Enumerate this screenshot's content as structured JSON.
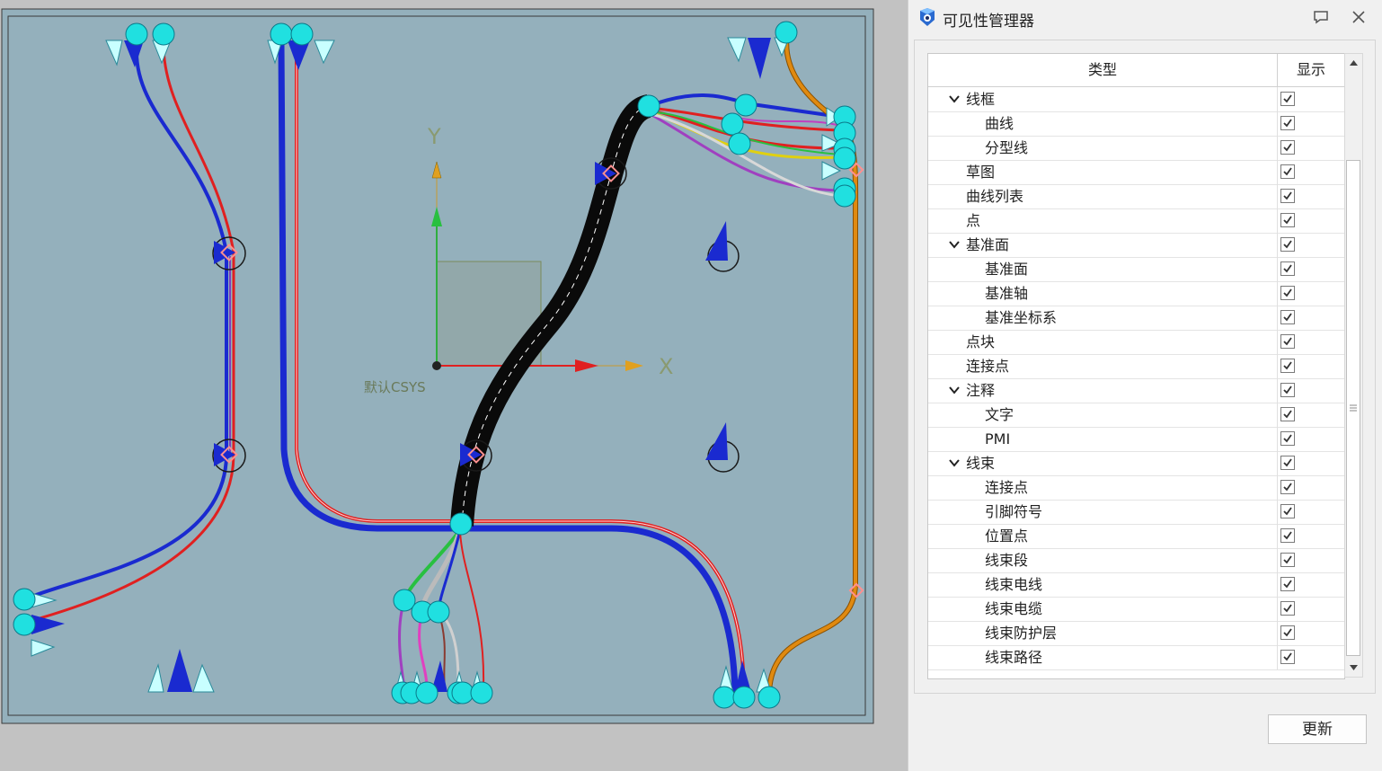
{
  "viewport": {
    "axis_x_label": "X",
    "axis_y_label": "Y",
    "csys_label": "默认CSYS",
    "colors": {
      "background": "#94b0bc",
      "wire_red": "#e02020",
      "wire_blue": "#1a2ad0",
      "bundle_black": "#0a0a0a",
      "cable_orange": "#e08a10",
      "connector_cyan": "#20e0e0"
    }
  },
  "panel": {
    "title": "可见性管理器",
    "logo_icon": "visibility-manager-icon",
    "columns": {
      "type": "类型",
      "show": "显示"
    },
    "items": [
      {
        "label": "线框",
        "level": 0,
        "expandable": true,
        "checked": true
      },
      {
        "label": "曲线",
        "level": 1,
        "expandable": false,
        "checked": true
      },
      {
        "label": "分型线",
        "level": 1,
        "expandable": false,
        "checked": true
      },
      {
        "label": "草图",
        "level": 0,
        "expandable": false,
        "checked": true
      },
      {
        "label": "曲线列表",
        "level": 0,
        "expandable": false,
        "checked": true
      },
      {
        "label": "点",
        "level": 0,
        "expandable": false,
        "checked": true
      },
      {
        "label": "基准面",
        "level": 0,
        "expandable": true,
        "checked": true
      },
      {
        "label": "基准面",
        "level": 1,
        "expandable": false,
        "checked": true
      },
      {
        "label": "基准轴",
        "level": 1,
        "expandable": false,
        "checked": true
      },
      {
        "label": "基准坐标系",
        "level": 1,
        "expandable": false,
        "checked": true
      },
      {
        "label": "点块",
        "level": 0,
        "expandable": false,
        "checked": true
      },
      {
        "label": "连接点",
        "level": 0,
        "expandable": false,
        "checked": true
      },
      {
        "label": "注释",
        "level": 0,
        "expandable": true,
        "checked": true
      },
      {
        "label": "文字",
        "level": 1,
        "expandable": false,
        "checked": true
      },
      {
        "label": "PMI",
        "level": 1,
        "expandable": false,
        "checked": true
      },
      {
        "label": "线束",
        "level": 0,
        "expandable": true,
        "checked": true
      },
      {
        "label": "连接点",
        "level": 1,
        "expandable": false,
        "checked": true
      },
      {
        "label": "引脚符号",
        "level": 1,
        "expandable": false,
        "checked": true
      },
      {
        "label": "位置点",
        "level": 1,
        "expandable": false,
        "checked": true
      },
      {
        "label": "线束段",
        "level": 1,
        "expandable": false,
        "checked": true
      },
      {
        "label": "线束电线",
        "level": 1,
        "expandable": false,
        "checked": true
      },
      {
        "label": "线束电缆",
        "level": 1,
        "expandable": false,
        "checked": true
      },
      {
        "label": "线束防护层",
        "level": 1,
        "expandable": false,
        "checked": true
      },
      {
        "label": "线束路径",
        "level": 1,
        "expandable": false,
        "checked": true
      }
    ],
    "update_label": "更新"
  }
}
